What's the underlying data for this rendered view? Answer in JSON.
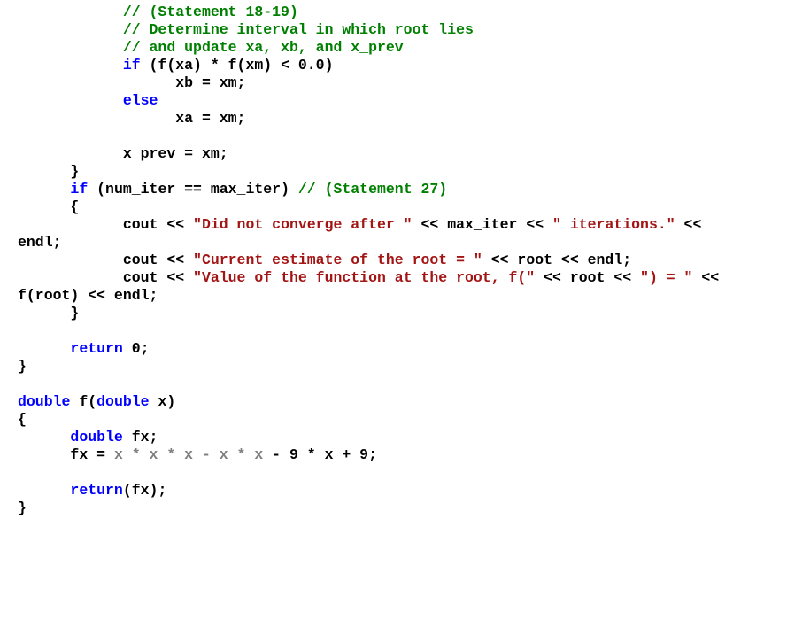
{
  "code": {
    "comment_stmt1819": "// (Statement 18-19)",
    "comment_det": "// Determine interval in which root lies",
    "comment_upd": "// and update xa, xb, and x_prev",
    "kw_if": "if",
    "cond_if_fx": " (f(xa) * f(xm) < ",
    "num_zero": "0.0",
    "cond_if_fx_close": ")",
    "stmt_xb": "xb = xm;",
    "kw_else": "else",
    "stmt_xa": "xa = xm;",
    "stmt_xprev": "x_prev = xm;",
    "brace_close1": "}",
    "cond_numiter_a": " (num_iter == max_iter) ",
    "comment_stmt27": "// (Statement 27)",
    "brace_open1": "{",
    "cout": "cout << ",
    "str_didnot": "\"Did not converge after \"",
    "mid1": " << max_iter << ",
    "str_iter": "\" iterations.\"",
    "tail1a": " <<",
    "tail1b": "endl;",
    "str_est": "\"Current estimate of the root = \"",
    "mid2": " << root << endl;",
    "str_val": "\"Value of the function at the root, f(\"",
    "mid3a": " << root << ",
    "str_paren_eq": "\") = \"",
    "mid3b": " <<",
    "tail3": "f(root) << endl;",
    "brace_close2": "}",
    "kw_return": "return",
    "ret0": " 0;",
    "brace_close3": "}",
    "kw_double": "double",
    "fdecl_a": " f(",
    "fdecl_b": " x)",
    "brace_open2": "{",
    "decl_fx": " fx;",
    "fx_lhs": "fx = ",
    "fx_dim": "x * x * x - x * x",
    "fx_rest": " - 9 * x + 9;",
    "ret_fx": "(fx);",
    "brace_close4": "}"
  }
}
